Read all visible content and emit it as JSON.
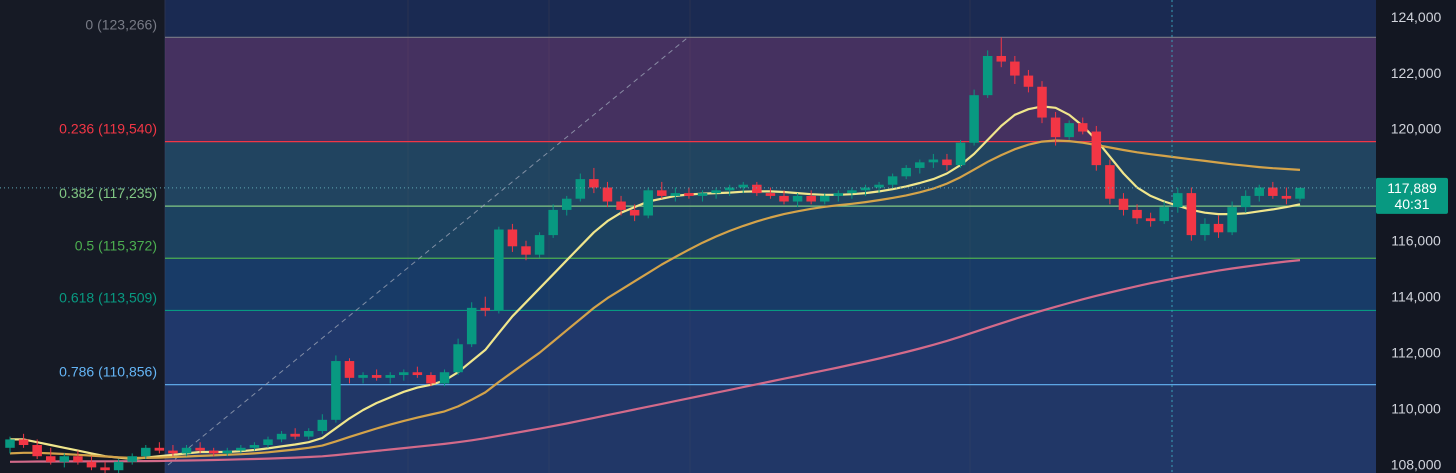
{
  "chart_data": {
    "type": "candlestick",
    "price_axis": {
      "ticks": [
        124000,
        122000,
        120000,
        118000,
        116000,
        114000,
        112000,
        110000,
        108000
      ],
      "tick_labels": [
        "124,000",
        "122,000",
        "120,000",
        "118,000",
        "116,000",
        "114,000",
        "112,000",
        "110,000",
        "108,000"
      ],
      "range": [
        107700,
        124600
      ]
    },
    "fibonacci_levels": [
      {
        "label": "0 (123,266)",
        "price": 123266,
        "color": "#787b86"
      },
      {
        "label": "0.236 (119,540)",
        "price": 119540,
        "color": "#f23645"
      },
      {
        "label": "0.382 (117,235)",
        "price": 117235,
        "color": "#81c784"
      },
      {
        "label": "0.5 (115,372)",
        "price": 115372,
        "color": "#4caf50"
      },
      {
        "label": "0.618 (113,509)",
        "price": 113509,
        "color": "#089981"
      },
      {
        "label": "0.786 (110,856)",
        "price": 110856,
        "color": "#64b5f6"
      }
    ],
    "fib_bands": [
      {
        "from": 123266,
        "to": 119540,
        "color": "#8c3c78"
      },
      {
        "from": 119540,
        "to": 117235,
        "color": "#2e6f78"
      },
      {
        "from": 117235,
        "to": 115372,
        "color": "#1f6a7a"
      },
      {
        "from": 115372,
        "to": 113509,
        "color": "#16568c"
      },
      {
        "from": 113509,
        "to": 110856,
        "color": "#2a4f96"
      },
      {
        "from": 110856,
        "to": 107700,
        "color": "#2e4b8c"
      }
    ],
    "last_price": {
      "label": "117,889",
      "countdown": "40:31",
      "price": 117889,
      "color": "#089981"
    },
    "candles": [
      [
        108600,
        109000,
        108400,
        108900
      ],
      [
        108900,
        109100,
        108600,
        108700
      ],
      [
        108700,
        108900,
        108200,
        108300
      ],
      [
        108300,
        108600,
        108000,
        108100
      ],
      [
        108100,
        108400,
        107900,
        108300
      ],
      [
        108300,
        108500,
        108000,
        108100
      ],
      [
        108100,
        108300,
        107800,
        107900
      ],
      [
        107900,
        108100,
        107700,
        107800
      ],
      [
        107800,
        108200,
        107700,
        108100
      ],
      [
        108100,
        108400,
        108000,
        108300
      ],
      [
        108300,
        108700,
        108200,
        108600
      ],
      [
        108600,
        108800,
        108400,
        108500
      ],
      [
        108500,
        108700,
        108300,
        108400
      ],
      [
        108400,
        108700,
        108300,
        108600
      ],
      [
        108600,
        108800,
        108400,
        108500
      ],
      [
        108500,
        108600,
        108300,
        108400
      ],
      [
        108400,
        108600,
        108300,
        108500
      ],
      [
        108500,
        108700,
        108400,
        108600
      ],
      [
        108600,
        108800,
        108500,
        108700
      ],
      [
        108700,
        109000,
        108600,
        108900
      ],
      [
        108900,
        109200,
        108800,
        109100
      ],
      [
        109100,
        109300,
        108900,
        109000
      ],
      [
        109000,
        109300,
        108900,
        109200
      ],
      [
        109200,
        109800,
        109100,
        109600
      ],
      [
        109600,
        111900,
        109500,
        111700
      ],
      [
        111700,
        111800,
        110900,
        111100
      ],
      [
        111100,
        111300,
        110900,
        111200
      ],
      [
        111200,
        111400,
        111000,
        111100
      ],
      [
        111100,
        111300,
        110900,
        111200
      ],
      [
        111200,
        111400,
        111000,
        111300
      ],
      [
        111300,
        111500,
        111100,
        111200
      ],
      [
        111200,
        111300,
        110800,
        110900
      ],
      [
        110900,
        111400,
        110800,
        111300
      ],
      [
        111300,
        112500,
        111200,
        112300
      ],
      [
        112300,
        113800,
        112200,
        113600
      ],
      [
        113600,
        114000,
        113300,
        113500
      ],
      [
        113500,
        116500,
        113400,
        116400
      ],
      [
        116400,
        116600,
        115600,
        115800
      ],
      [
        115800,
        116000,
        115300,
        115500
      ],
      [
        115500,
        116300,
        115400,
        116200
      ],
      [
        116200,
        117300,
        116100,
        117100
      ],
      [
        117100,
        117600,
        116900,
        117500
      ],
      [
        117500,
        118400,
        117400,
        118200
      ],
      [
        118200,
        118600,
        117700,
        117900
      ],
      [
        117900,
        118100,
        117200,
        117400
      ],
      [
        117400,
        117600,
        116900,
        117100
      ],
      [
        117100,
        117300,
        116700,
        116900
      ],
      [
        116900,
        117900,
        116800,
        117800
      ],
      [
        117800,
        118100,
        117500,
        117600
      ],
      [
        117600,
        117900,
        117400,
        117700
      ],
      [
        117700,
        117900,
        117500,
        117600
      ],
      [
        117600,
        117800,
        117400,
        117700
      ],
      [
        117700,
        117900,
        117500,
        117800
      ],
      [
        117800,
        118000,
        117600,
        117900
      ],
      [
        117900,
        118100,
        117700,
        118000
      ],
      [
        118000,
        118100,
        117600,
        117700
      ],
      [
        117700,
        117900,
        117500,
        117600
      ],
      [
        117600,
        117800,
        117300,
        117400
      ],
      [
        117400,
        117700,
        117200,
        117600
      ],
      [
        117600,
        117800,
        117300,
        117400
      ],
      [
        117400,
        117700,
        117300,
        117600
      ],
      [
        117600,
        117800,
        117400,
        117700
      ],
      [
        117700,
        117900,
        117500,
        117800
      ],
      [
        117800,
        118000,
        117600,
        117900
      ],
      [
        117900,
        118100,
        117700,
        118000
      ],
      [
        118000,
        118400,
        117900,
        118300
      ],
      [
        118300,
        118700,
        118200,
        118600
      ],
      [
        118600,
        118900,
        118400,
        118800
      ],
      [
        118800,
        119100,
        118600,
        118900
      ],
      [
        118900,
        119100,
        118500,
        118700
      ],
      [
        118700,
        119600,
        118600,
        119500
      ],
      [
        119500,
        121400,
        119400,
        121200
      ],
      [
        121200,
        122800,
        121100,
        122600
      ],
      [
        122600,
        123266,
        122200,
        122400
      ],
      [
        122400,
        122600,
        121600,
        121900
      ],
      [
        121900,
        122100,
        121300,
        121500
      ],
      [
        121500,
        121700,
        120200,
        120400
      ],
      [
        120400,
        120600,
        119400,
        119700
      ],
      [
        119700,
        120300,
        119600,
        120200
      ],
      [
        120200,
        120400,
        119800,
        119900
      ],
      [
        119900,
        120100,
        118500,
        118700
      ],
      [
        118700,
        118900,
        117300,
        117500
      ],
      [
        117500,
        117700,
        116900,
        117100
      ],
      [
        117100,
        117300,
        116600,
        116800
      ],
      [
        116800,
        117000,
        116500,
        116700
      ],
      [
        116700,
        117400,
        116600,
        117200
      ],
      [
        117200,
        117900,
        117000,
        117700
      ],
      [
        117700,
        117900,
        116000,
        116200
      ],
      [
        116200,
        116800,
        116000,
        116600
      ],
      [
        116600,
        116900,
        116100,
        116300
      ],
      [
        116300,
        117400,
        116200,
        117200
      ],
      [
        117200,
        117800,
        117000,
        117600
      ],
      [
        117600,
        118000,
        117400,
        117900
      ],
      [
        117900,
        118100,
        117500,
        117600
      ],
      [
        117600,
        117900,
        117300,
        117500
      ],
      [
        117500,
        117900,
        117400,
        117889
      ]
    ],
    "moving_averages": [
      {
        "color": "#f0e68c",
        "values": [
          108900,
          108900,
          108800,
          108700,
          108600,
          108500,
          108400,
          108300,
          108250,
          108200,
          108250,
          108300,
          108350,
          108400,
          108450,
          108450,
          108450,
          108480,
          108520,
          108580,
          108650,
          108720,
          108800,
          108950,
          109300,
          109650,
          109950,
          110200,
          110400,
          110600,
          110750,
          110850,
          111000,
          111300,
          111700,
          112100,
          112700,
          113300,
          113800,
          114300,
          114800,
          115300,
          115800,
          116300,
          116700,
          117000,
          117200,
          117400,
          117500,
          117600,
          117650,
          117680,
          117700,
          117720,
          117750,
          117760,
          117760,
          117740,
          117700,
          117660,
          117640,
          117640,
          117660,
          117700,
          117760,
          117840,
          117940,
          118060,
          118200,
          118400,
          118700,
          119100,
          119600,
          120100,
          120500,
          120700,
          120800,
          120750,
          120500,
          120100,
          119600,
          119000,
          118400,
          117900,
          117600,
          117400,
          117250,
          117100,
          117000,
          116950,
          116950,
          116980,
          117050,
          117120,
          117200,
          117300
        ]
      },
      {
        "color": "#d4a34a",
        "values": [
          108400,
          108420,
          108420,
          108400,
          108380,
          108350,
          108320,
          108290,
          108260,
          108240,
          108240,
          108250,
          108270,
          108290,
          108310,
          108330,
          108350,
          108370,
          108400,
          108440,
          108490,
          108540,
          108600,
          108680,
          108830,
          108990,
          109140,
          109290,
          109430,
          109560,
          109680,
          109790,
          109900,
          110080,
          110320,
          110580,
          110950,
          111300,
          111650,
          112000,
          112400,
          112800,
          113200,
          113600,
          113950,
          114250,
          114550,
          114850,
          115150,
          115420,
          115680,
          115930,
          116150,
          116350,
          116530,
          116690,
          116830,
          116950,
          117050,
          117140,
          117210,
          117270,
          117320,
          117380,
          117450,
          117530,
          117620,
          117730,
          117860,
          118040,
          118270,
          118540,
          118820,
          119060,
          119270,
          119430,
          119540,
          119580,
          119560,
          119500,
          119420,
          119330,
          119240,
          119160,
          119090,
          119030,
          118970,
          118910,
          118850,
          118790,
          118730,
          118680,
          118630,
          118590,
          118560,
          118530
        ]
      },
      {
        "color": "#d36a8a",
        "values": [
          108100,
          108105,
          108110,
          108112,
          108114,
          108115,
          108116,
          108117,
          108118,
          108120,
          108125,
          108130,
          108138,
          108146,
          108155,
          108165,
          108176,
          108188,
          108200,
          108215,
          108232,
          108250,
          108270,
          108295,
          108340,
          108390,
          108440,
          108490,
          108540,
          108590,
          108640,
          108690,
          108740,
          108800,
          108870,
          108945,
          109030,
          109115,
          109200,
          109285,
          109375,
          109470,
          109570,
          109670,
          109770,
          109870,
          109970,
          110070,
          110170,
          110270,
          110370,
          110470,
          110570,
          110670,
          110770,
          110870,
          110970,
          111070,
          111170,
          111270,
          111370,
          111470,
          111575,
          111680,
          111790,
          111905,
          112025,
          112150,
          112280,
          112420,
          112570,
          112730,
          112890,
          113050,
          113205,
          113355,
          113500,
          113640,
          113775,
          113905,
          114030,
          114150,
          114265,
          114375,
          114480,
          114580,
          114675,
          114765,
          114850,
          114930,
          115005,
          115075,
          115140,
          115200,
          115255,
          115305
        ]
      }
    ]
  }
}
